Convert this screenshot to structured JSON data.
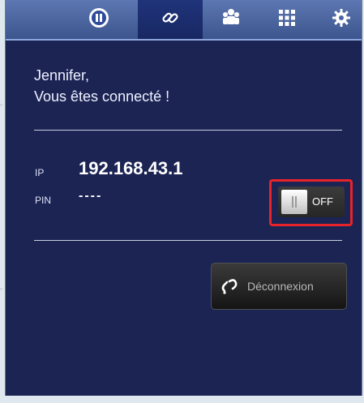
{
  "tabs": [
    {
      "id": "pause",
      "icon": "pause-icon",
      "active": false
    },
    {
      "id": "link",
      "icon": "link-icon",
      "active": true
    },
    {
      "id": "users",
      "icon": "users-icon",
      "active": false
    },
    {
      "id": "grid",
      "icon": "grid-icon",
      "active": false
    },
    {
      "id": "settings",
      "icon": "gear-icon",
      "active": false
    }
  ],
  "greeting": {
    "line1": "Jennifer,",
    "line2": "Vous êtes connecté !"
  },
  "ip": {
    "label": "IP",
    "value": "192.168.43.1"
  },
  "pin": {
    "label": "PIN",
    "value": "----"
  },
  "toggle": {
    "label": "OFF",
    "state": "off"
  },
  "disconnect": {
    "label": "Déconnexion",
    "icon": "link-icon"
  },
  "colors": {
    "panel": "#1c2454",
    "tabbar": "#4a64a0",
    "highlight": "#e8232a"
  }
}
